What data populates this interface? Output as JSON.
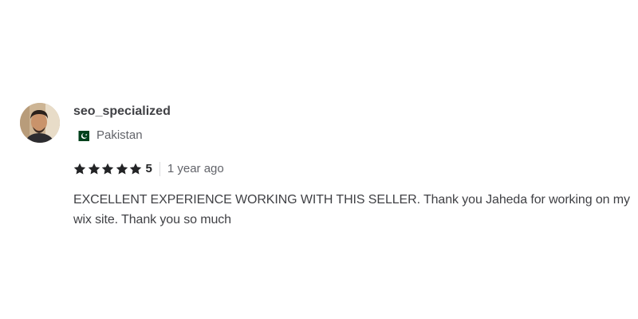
{
  "review": {
    "username": "seo_specialized",
    "country": "Pakistan",
    "flag_icon": "pakistan-flag-icon",
    "rating": {
      "stars": 5,
      "max_stars": 5,
      "score_label": "5",
      "star_color": "#222325"
    },
    "time_ago": "1 year ago",
    "text": "EXCELLENT EXPERIENCE WORKING WITH THIS SELLER. Thank you Jaheda for working on my wix site. Thank you so much"
  }
}
